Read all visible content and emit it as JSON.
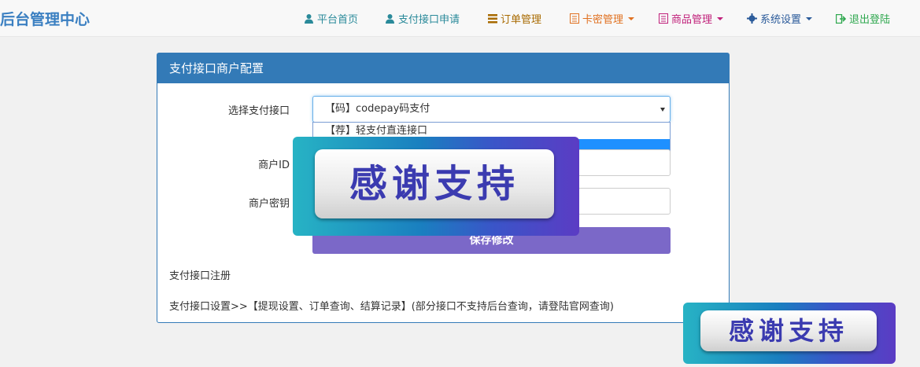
{
  "brand": "后台管理中心",
  "nav": [
    {
      "label": "平台首页",
      "icon": "user-icon",
      "color": "#2a8a9a",
      "dropdown": false
    },
    {
      "label": "支付接口申请",
      "icon": "user-icon",
      "color": "#2a8a9a",
      "dropdown": false
    },
    {
      "label": "订单管理",
      "icon": "list-icon",
      "color": "#a86a00",
      "dropdown": false
    },
    {
      "label": "卡密管理",
      "icon": "book-icon",
      "color": "#e07020",
      "dropdown": true
    },
    {
      "label": "商品管理",
      "icon": "book-icon",
      "color": "#c0207a",
      "dropdown": true
    },
    {
      "label": "系统设置",
      "icon": "gear-icon",
      "color": "#2a5a9a",
      "dropdown": true
    },
    {
      "label": "退出登陆",
      "icon": "logout-icon",
      "color": "#2fa84f",
      "dropdown": false
    }
  ],
  "panel": {
    "title": "支付接口商户配置",
    "select_label": "选择支付接口",
    "select_value": "【码】codepay码支付",
    "dropdown_option_1": "【荐】轻支付直连接口",
    "merchant_id_label": "商户ID",
    "merchant_key_label": "商户密钥",
    "save_label": "保存修改",
    "reg_text": "支付接口注册",
    "settings_text": "支付接口设置>>【提现设置、订单查询、结算记录】(部分接口不支持后台查询，请登陆官网查询)"
  },
  "overlay": {
    "text": "感谢支持"
  }
}
